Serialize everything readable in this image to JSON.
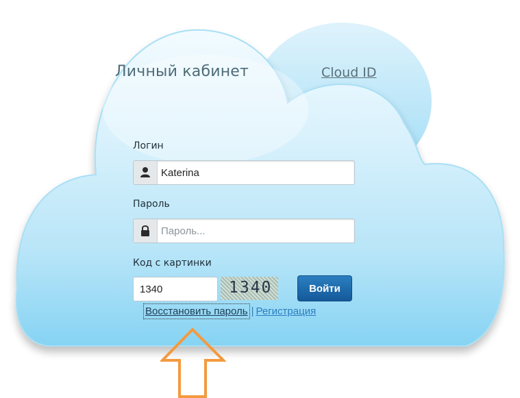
{
  "header": {
    "title": "Личный кабинет",
    "cloud_id_link": "Cloud ID"
  },
  "form": {
    "login_label": "Логин",
    "login_value": "Katerina",
    "password_label": "Пароль",
    "password_placeholder": "Пароль...",
    "captcha_label": "Код с картинки",
    "captcha_value": "1340",
    "captcha_image_text": "1340",
    "submit_label": "Войти"
  },
  "links": {
    "restore_password": "Восстановить пароль",
    "separator": "|",
    "register": "Регистрация"
  },
  "icons": {
    "login": "user-icon",
    "password": "lock-icon",
    "annotation": "up-arrow-icon"
  },
  "colors": {
    "cloud_top": "#e8f6fd",
    "cloud_bottom": "#7fd0f2",
    "button": "#1b68a8",
    "link": "#2a7dc0",
    "arrow": "#f39a3e"
  }
}
